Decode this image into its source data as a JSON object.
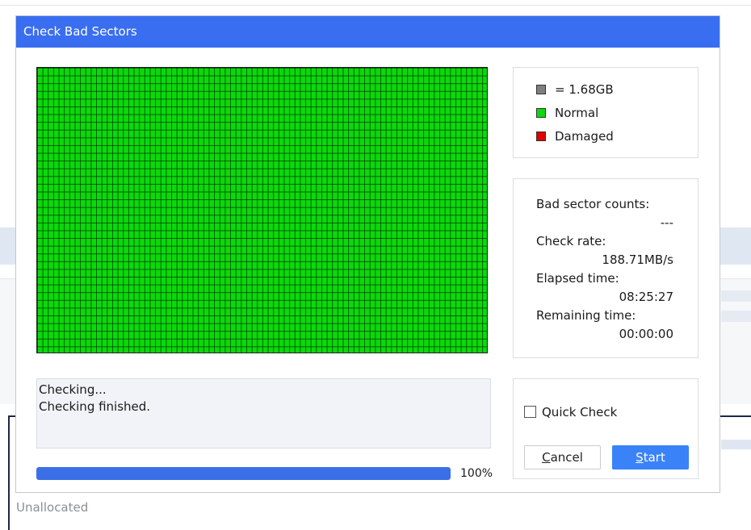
{
  "dialog": {
    "title": "Check Bad Sectors"
  },
  "legend": {
    "items": [
      {
        "label": "= 1.68GB",
        "color": "#7f7f7f"
      },
      {
        "label": "Normal",
        "color": "#0cd80c"
      },
      {
        "label": "Damaged",
        "color": "#e00000"
      }
    ]
  },
  "sector_grid": {
    "status": "Normal",
    "color": "#0cd80c"
  },
  "stats": {
    "bad_sector_counts_label": "Bad sector counts:",
    "bad_sector_counts_value": "---",
    "check_rate_label": "Check rate:",
    "check_rate_value": "188.71MB/s",
    "elapsed_time_label": "Elapsed time:",
    "elapsed_time_value": "08:25:27",
    "remaining_time_label": "Remaining time:",
    "remaining_time_value": "00:00:00"
  },
  "log": {
    "lines": [
      "Checking...",
      "Checking finished."
    ]
  },
  "progress": {
    "value": 100,
    "label": "100%"
  },
  "controls": {
    "quick_check_label": "Quick Check",
    "quick_check_checked": false,
    "cancel_label_prefix": "C",
    "cancel_label_rest": "ancel",
    "start_label_prefix": "S",
    "start_label_rest": "tart"
  },
  "background": {
    "unallocated_label": "Unallocated"
  },
  "colors": {
    "title_bar": "#3a6ef0",
    "start_button": "#3a82f7",
    "progress_fill": "#3b6fe8"
  }
}
